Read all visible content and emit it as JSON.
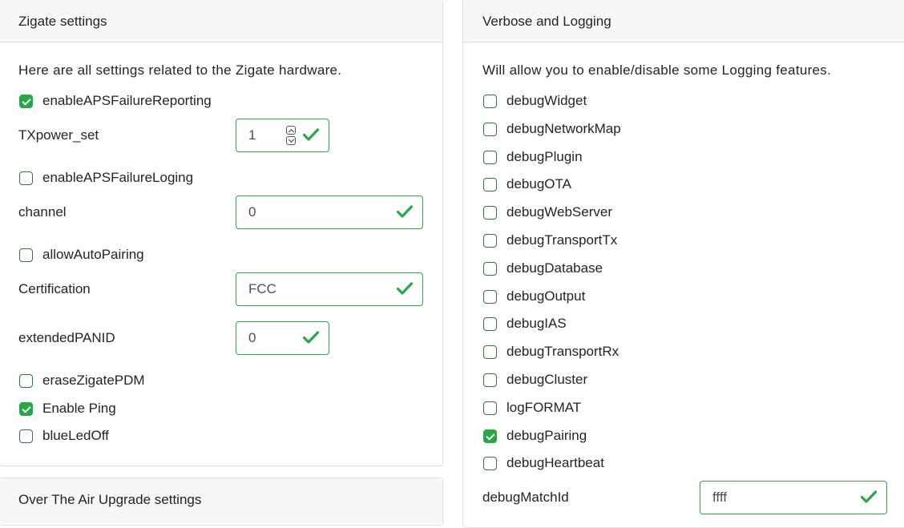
{
  "zigate": {
    "title": "Zigate settings",
    "intro": "Here are all settings related to the Zigate hardware.",
    "enableAPSFailureReporting": {
      "label": "enableAPSFailureReporting",
      "checked": true
    },
    "txpower": {
      "label": "TXpower_set",
      "value": "1"
    },
    "enableAPSFailureLoging": {
      "label": "enableAPSFailureLoging",
      "checked": false
    },
    "channel": {
      "label": "channel",
      "value": "0"
    },
    "allowAutoPairing": {
      "label": "allowAutoPairing",
      "checked": false
    },
    "certification": {
      "label": "Certification",
      "value": "FCC"
    },
    "extendedPANID": {
      "label": "extendedPANID",
      "value": "0"
    },
    "eraseZigatePDM": {
      "label": "eraseZigatePDM",
      "checked": false
    },
    "enablePing": {
      "label": "Enable Ping",
      "checked": true
    },
    "blueLedOff": {
      "label": "blueLedOff",
      "checked": false
    }
  },
  "ota": {
    "title": "Over The Air Upgrade settings"
  },
  "logging": {
    "title": "Verbose and Logging",
    "intro": "Will allow you to enable/disable some Logging features.",
    "items": [
      {
        "label": "debugWidget",
        "checked": false
      },
      {
        "label": "debugNetworkMap",
        "checked": false
      },
      {
        "label": "debugPlugin",
        "checked": false
      },
      {
        "label": "debugOTA",
        "checked": false
      },
      {
        "label": "debugWebServer",
        "checked": false
      },
      {
        "label": "debugTransportTx",
        "checked": false
      },
      {
        "label": "debugDatabase",
        "checked": false
      },
      {
        "label": "debugOutput",
        "checked": false
      },
      {
        "label": "debugIAS",
        "checked": false
      },
      {
        "label": "debugTransportRx",
        "checked": false
      },
      {
        "label": "debugCluster",
        "checked": false
      },
      {
        "label": "logFORMAT",
        "checked": false
      },
      {
        "label": "debugPairing",
        "checked": true
      },
      {
        "label": "debugHeartbeat",
        "checked": false
      }
    ],
    "matchId": {
      "label": "debugMatchId",
      "value": "ffff"
    }
  },
  "colors": {
    "valid": "#28a745",
    "header_bg": "#f7f7f7",
    "border": "#dfdfdf"
  },
  "icons": {
    "valid": "check-icon",
    "spinner_up": "chevron-up-icon",
    "spinner_down": "chevron-down-icon"
  }
}
